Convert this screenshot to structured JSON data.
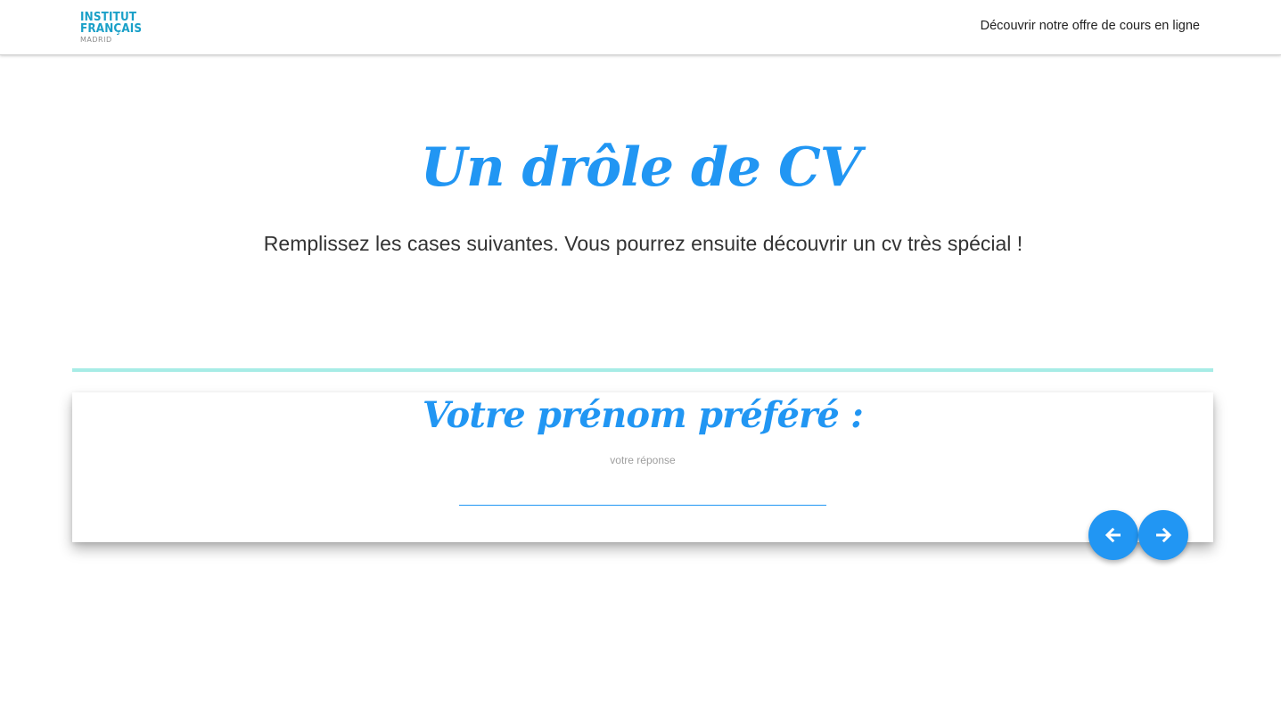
{
  "header": {
    "logo": {
      "line1": "INSTITUT",
      "line2": "FRANÇAIS",
      "line3": "MADRID"
    },
    "nav_link": "Découvrir notre offre de cours en ligne"
  },
  "hero": {
    "title": "Un drôle de CV",
    "subtitle": "Remplissez les cases suivantes. Vous pourrez ensuite découvrir un cv très spécial !"
  },
  "question": {
    "title": "Votre prénom préféré :",
    "answer_label": "votre réponse",
    "answer_value": ""
  },
  "controls": {
    "prev_icon": "arrow-left-icon",
    "next_icon": "arrow-right-icon"
  },
  "colors": {
    "accent": "#2196f3",
    "logo": "#1aa0c8",
    "divider": "#a7ece6",
    "text": "#333333",
    "label": "#9e9e9e"
  }
}
